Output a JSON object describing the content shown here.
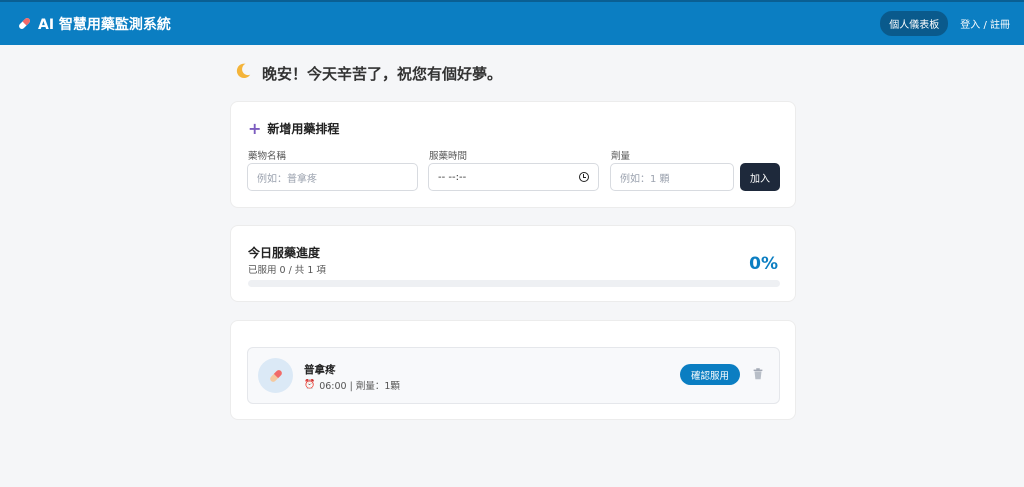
{
  "header": {
    "title": "AI 智慧用藥監測系統",
    "dashboard_label": "個人儀表板",
    "login_label": "登入 / 註冊"
  },
  "greeting": {
    "text": "晚安！今天辛苦了，祝您有個好夢。"
  },
  "add_schedule": {
    "title": "新增用藥排程",
    "name_label": "藥物名稱",
    "name_placeholder": "例如：普拿疼",
    "time_label": "服藥時間",
    "time_value": "-- --:--",
    "dose_label": "劑量",
    "dose_placeholder": "例如：1 顆",
    "add_button": "加入"
  },
  "progress": {
    "title": "今日服藥進度",
    "subtitle": "已服用 0 / 共 1 項",
    "percent_label": "0%",
    "percent": 0
  },
  "medications": [
    {
      "name": "普拿疼",
      "meta": "06:00 | 劑量：1顆",
      "confirm_label": "確認服用"
    }
  ],
  "colors": {
    "primary": "#0b7ec2",
    "dark_button": "#1e293b",
    "accent_plus": "#7c5cbf"
  }
}
